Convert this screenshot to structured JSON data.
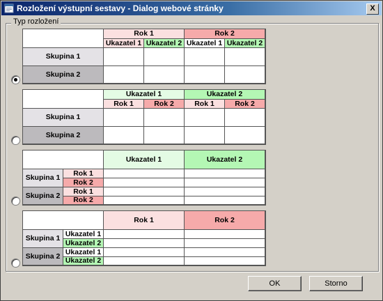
{
  "window": {
    "title": "Rozložení výstupní sestavy - Dialog webové stránky",
    "close_glyph": "X"
  },
  "group": {
    "legend": "Typ rozložení"
  },
  "layout1": {
    "selected": true,
    "year1": "Rok 1",
    "year2": "Rok 2",
    "ind1": "Ukazatel 1",
    "ind2": "Ukazatel 2",
    "grp1": "Skupina 1",
    "grp2": "Skupina 2"
  },
  "layout2": {
    "selected": false,
    "ind1": "Ukazatel 1",
    "ind2": "Ukazatel 2",
    "year1": "Rok 1",
    "year2": "Rok 2",
    "grp1": "Skupina 1",
    "grp2": "Skupina 2"
  },
  "layout3": {
    "selected": false,
    "ind1": "Ukazatel 1",
    "ind2": "Ukazatel 2",
    "grp1": "Skupina 1",
    "grp2": "Skupina 2",
    "year1": "Rok 1",
    "year2": "Rok 2"
  },
  "layout4": {
    "selected": false,
    "year1": "Rok 1",
    "year2": "Rok 2",
    "grp1": "Skupina 1",
    "grp2": "Skupina 2",
    "ind1": "Ukazatel 1",
    "ind2": "Ukazatel 2"
  },
  "buttons": {
    "ok": "OK",
    "cancel": "Storno"
  },
  "colors": {
    "title_start": "#0a246a",
    "title_end": "#a6caf0",
    "year1_fill": "#fbe0e0",
    "year2_fill": "#f6aaaa",
    "ind1_fill": "#e4fbe4",
    "ind2_fill": "#b4f7b4",
    "grp1_fill": "#e4e2e6",
    "grp2_fill": "#bcbabd"
  }
}
